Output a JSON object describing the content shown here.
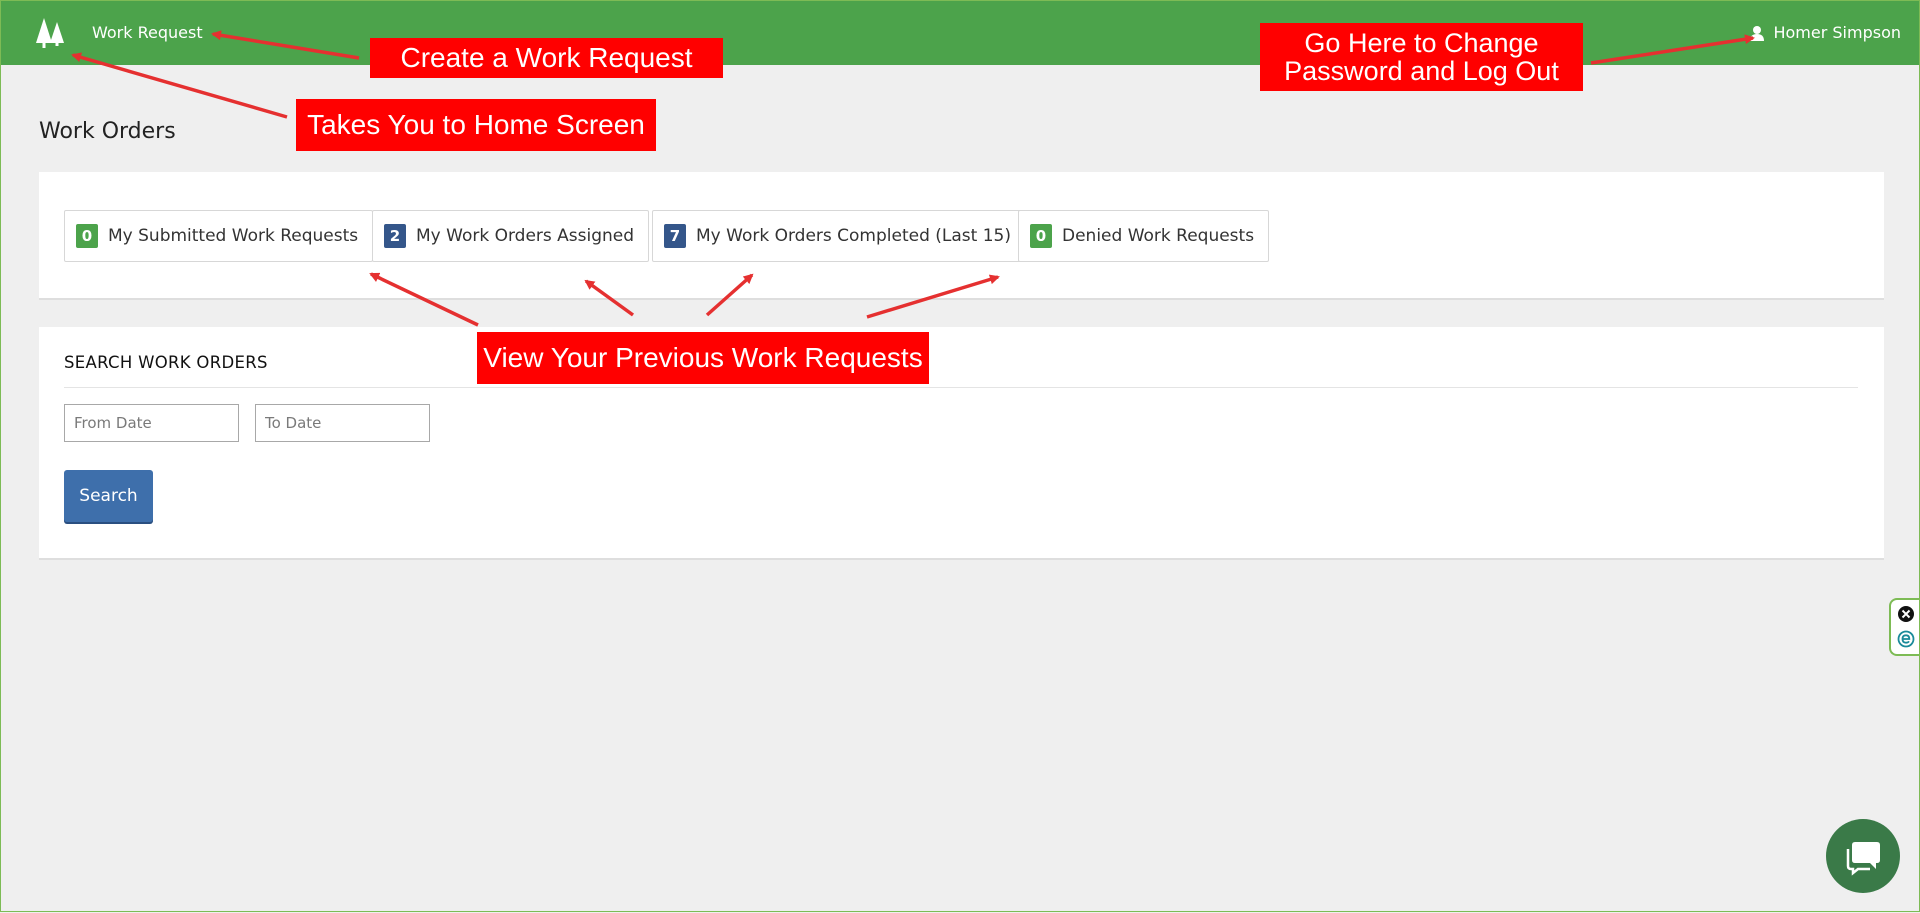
{
  "navbar": {
    "nav_link": "Work Request",
    "user_name": "Homer Simpson"
  },
  "page": {
    "title": "Work Orders"
  },
  "summary": {
    "buttons": [
      {
        "count": "0",
        "label": "My Submitted Work Requests",
        "badge_color": "#4ca34b"
      },
      {
        "count": "2",
        "label": "My Work Orders Assigned",
        "badge_color": "#34568a"
      },
      {
        "count": "7",
        "label": "My Work Orders Completed (Last 15)",
        "badge_color": "#34568a"
      },
      {
        "count": "0",
        "label": "Denied Work Requests",
        "badge_color": "#4ca34b"
      }
    ]
  },
  "search": {
    "title": "SEARCH WORK ORDERS",
    "from_placeholder": "From Date",
    "to_placeholder": "To Date",
    "button_label": "Search"
  },
  "annotations": {
    "create_request": "Create a Work Request",
    "home_screen": "Takes You to Home Screen",
    "password_logout": "Go Here to Change Password and Log Out",
    "previous_requests": "View Your Previous Work Requests"
  },
  "colors": {
    "navbar": "#4ca34b",
    "annotation": "#ff0000",
    "search_button": "#3e6fab",
    "chat_button": "#3a7a48"
  },
  "icons": {
    "logo": "trees-logo-icon",
    "user": "user-icon",
    "widget_close": "close-icon",
    "widget_e": "e-circle-icon",
    "chat": "chat-bubble-icon"
  }
}
